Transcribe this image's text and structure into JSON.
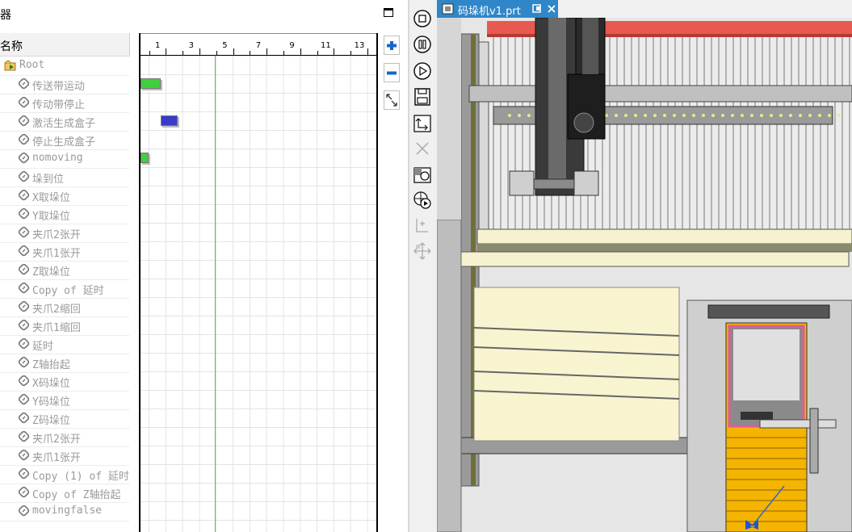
{
  "pane": {
    "title": "器",
    "name_header": "名称"
  },
  "tree": [
    {
      "label": "Root",
      "icon": "folder-run-icon"
    },
    {
      "label": "传送带运动",
      "icon": "link-icon"
    },
    {
      "label": "传动带停止",
      "icon": "link-icon"
    },
    {
      "label": "激活生成盒子",
      "icon": "link-icon"
    },
    {
      "label": "停止生成盒子",
      "icon": "link-icon"
    },
    {
      "label": "nomoving",
      "icon": "link-icon"
    },
    {
      "label": "垛到位",
      "icon": "link-icon"
    },
    {
      "label": "X取垛位",
      "icon": "link-icon"
    },
    {
      "label": "Y取垛位",
      "icon": "link-icon"
    },
    {
      "label": "夹爪2张开",
      "icon": "link-icon"
    },
    {
      "label": "夹爪1张开",
      "icon": "link-icon"
    },
    {
      "label": "Z取垛位",
      "icon": "link-icon"
    },
    {
      "label": "Copy of 延时",
      "icon": "link-icon"
    },
    {
      "label": "夹爪2缩回",
      "icon": "link-icon"
    },
    {
      "label": "夹爪1缩回",
      "icon": "link-icon"
    },
    {
      "label": "延时",
      "icon": "link-icon"
    },
    {
      "label": "Z轴抬起",
      "icon": "link-icon"
    },
    {
      "label": "X码垛位",
      "icon": "link-icon"
    },
    {
      "label": "Y码垛位",
      "icon": "link-icon"
    },
    {
      "label": "Z码垛位",
      "icon": "link-icon"
    },
    {
      "label": "夹爪2张开",
      "icon": "link-icon"
    },
    {
      "label": "夹爪1张开",
      "icon": "link-icon"
    },
    {
      "label": "Copy (1) of 延时",
      "icon": "link-icon"
    },
    {
      "label": "Copy of Z轴抬起",
      "icon": "link-icon"
    },
    {
      "label": "movingfalse",
      "icon": "link-icon"
    }
  ],
  "timeline": {
    "ticks": [
      "1",
      "3",
      "5",
      "7",
      "9",
      "11",
      "13"
    ],
    "cursor_time": 5,
    "bars": [
      {
        "row": 1,
        "start": 1,
        "end": 2.2,
        "color": "#3fcf3f"
      },
      {
        "row": 3,
        "start": 2.2,
        "end": 3.2,
        "color": "#3a3acb"
      },
      {
        "row": 5,
        "start": 1,
        "end": 1.5,
        "color": "#3fcf3f"
      }
    ]
  },
  "side_buttons": [
    "plus-icon",
    "minus-icon",
    "fit-icon"
  ],
  "toolbar": [
    "stop-icon",
    "pause-icon",
    "play-icon",
    "save-icon",
    "export-icon",
    "close-icon",
    "capture-icon",
    "simulate-icon",
    "align-icon",
    "move-icon"
  ],
  "tab": {
    "label": "码垛机v1.prt",
    "accent": "#2f86c8"
  }
}
